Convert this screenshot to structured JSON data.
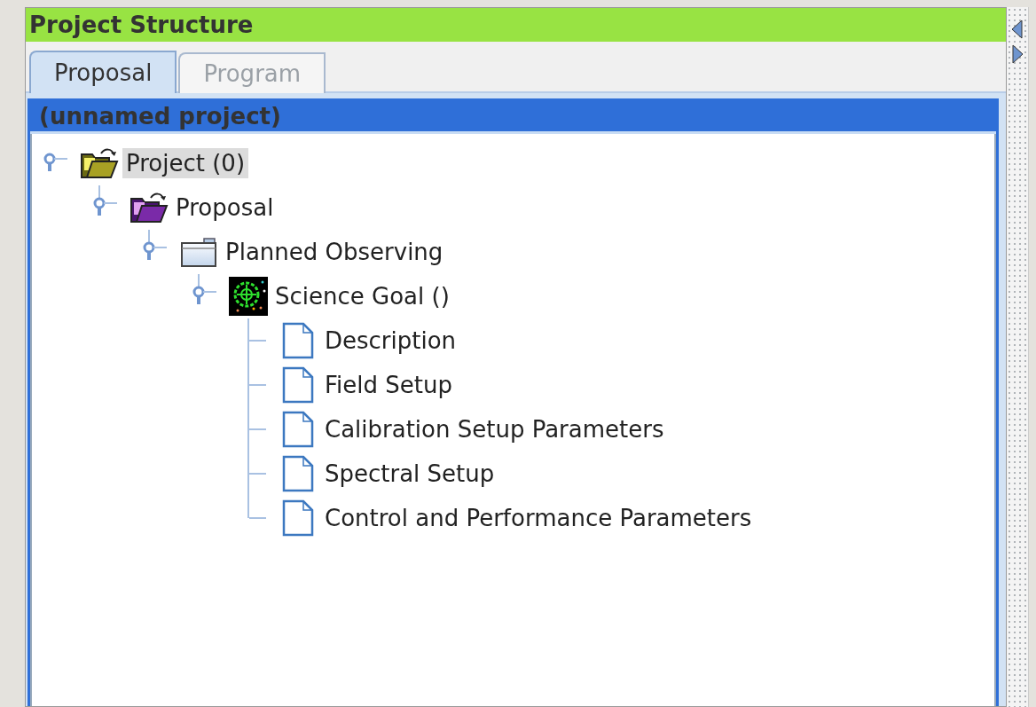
{
  "panel": {
    "title": "Project Structure"
  },
  "tabs": [
    {
      "label": "Proposal",
      "selected": true
    },
    {
      "label": "Program",
      "selected": false
    }
  ],
  "tree": {
    "title": "(unnamed project)",
    "nodes": [
      {
        "label": "Project (0)",
        "kind": "project",
        "selected": true,
        "expanded": true,
        "children": [
          {
            "label": "Proposal",
            "kind": "proposal",
            "selected": false,
            "expanded": true,
            "children": [
              {
                "label": "Planned Observing",
                "kind": "folder",
                "selected": false,
                "expanded": true,
                "children": [
                  {
                    "label": "Science Goal ()",
                    "kind": "goal",
                    "selected": false,
                    "expanded": true,
                    "children": [
                      {
                        "label": "Description",
                        "kind": "document",
                        "selected": false,
                        "expanded": false
                      },
                      {
                        "label": "Field Setup",
                        "kind": "document",
                        "selected": false,
                        "expanded": false
                      },
                      {
                        "label": "Calibration Setup Parameters",
                        "kind": "document",
                        "selected": false,
                        "expanded": false
                      },
                      {
                        "label": "Spectral Setup",
                        "kind": "document",
                        "selected": false,
                        "expanded": false
                      },
                      {
                        "label": "Control and Performance Parameters",
                        "kind": "document",
                        "selected": false,
                        "expanded": false
                      }
                    ]
                  }
                ]
              }
            ]
          }
        ]
      }
    ]
  }
}
